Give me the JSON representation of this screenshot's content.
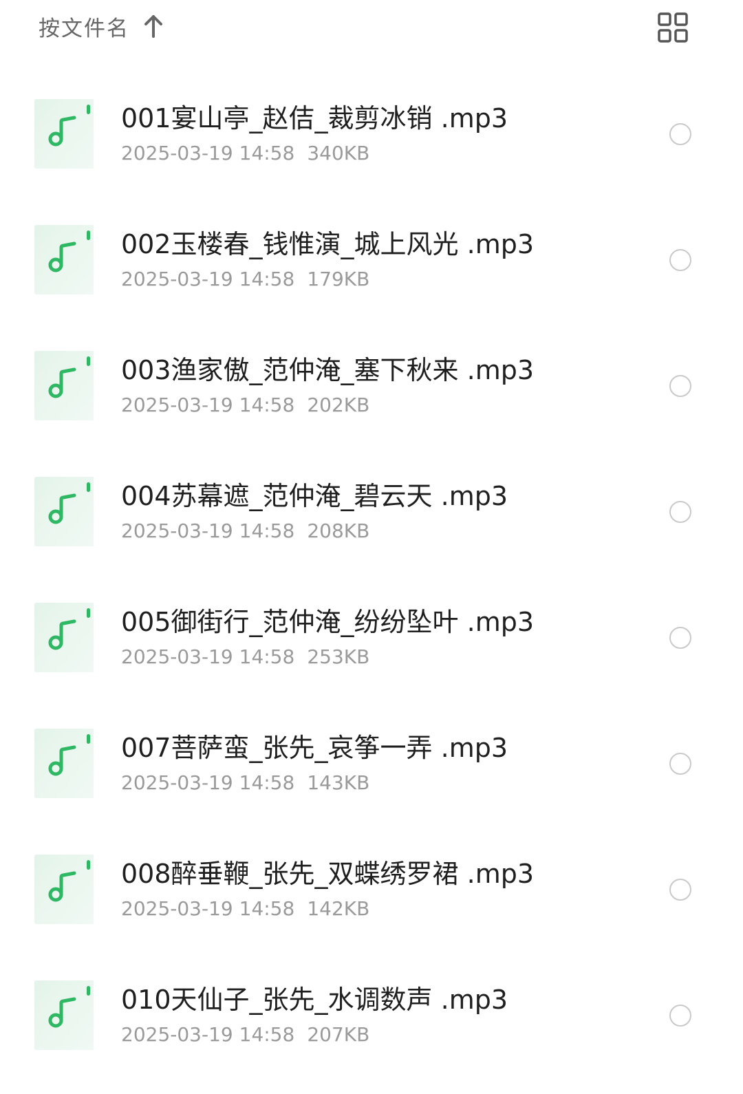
{
  "toolbar": {
    "sort_label": "按文件名",
    "sort_direction_icon": "arrow-up-icon",
    "view_toggle_icon": "grid-view-icon"
  },
  "colors": {
    "icon_bg": "#eaf6ef",
    "icon_accent": "#2fb863",
    "meta_text": "#9a9a9a",
    "name_text": "#1f1f1f"
  },
  "files": [
    {
      "name": "001宴山亭_赵佶_裁剪冰销 .mp3",
      "date": "2025-03-19 14:58",
      "size": "340KB",
      "icon": "music-file-icon"
    },
    {
      "name": "002玉楼春_钱惟演_城上风光 .mp3",
      "date": "2025-03-19 14:58",
      "size": "179KB",
      "icon": "music-file-icon"
    },
    {
      "name": "003渔家傲_范仲淹_塞下秋来 .mp3",
      "date": "2025-03-19 14:58",
      "size": "202KB",
      "icon": "music-file-icon"
    },
    {
      "name": "004苏幕遮_范仲淹_碧云天 .mp3",
      "date": "2025-03-19 14:58",
      "size": "208KB",
      "icon": "music-file-icon"
    },
    {
      "name": "005御街行_范仲淹_纷纷坠叶 .mp3",
      "date": "2025-03-19 14:58",
      "size": "253KB",
      "icon": "music-file-icon"
    },
    {
      "name": "007菩萨蛮_张先_哀筝一弄 .mp3",
      "date": "2025-03-19 14:58",
      "size": "143KB",
      "icon": "music-file-icon"
    },
    {
      "name": "008醉垂鞭_张先_双蝶绣罗裙 .mp3",
      "date": "2025-03-19 14:58",
      "size": "142KB",
      "icon": "music-file-icon"
    },
    {
      "name": "010天仙子_张先_水调数声 .mp3",
      "date": "2025-03-19 14:58",
      "size": "207KB",
      "icon": "music-file-icon"
    }
  ]
}
